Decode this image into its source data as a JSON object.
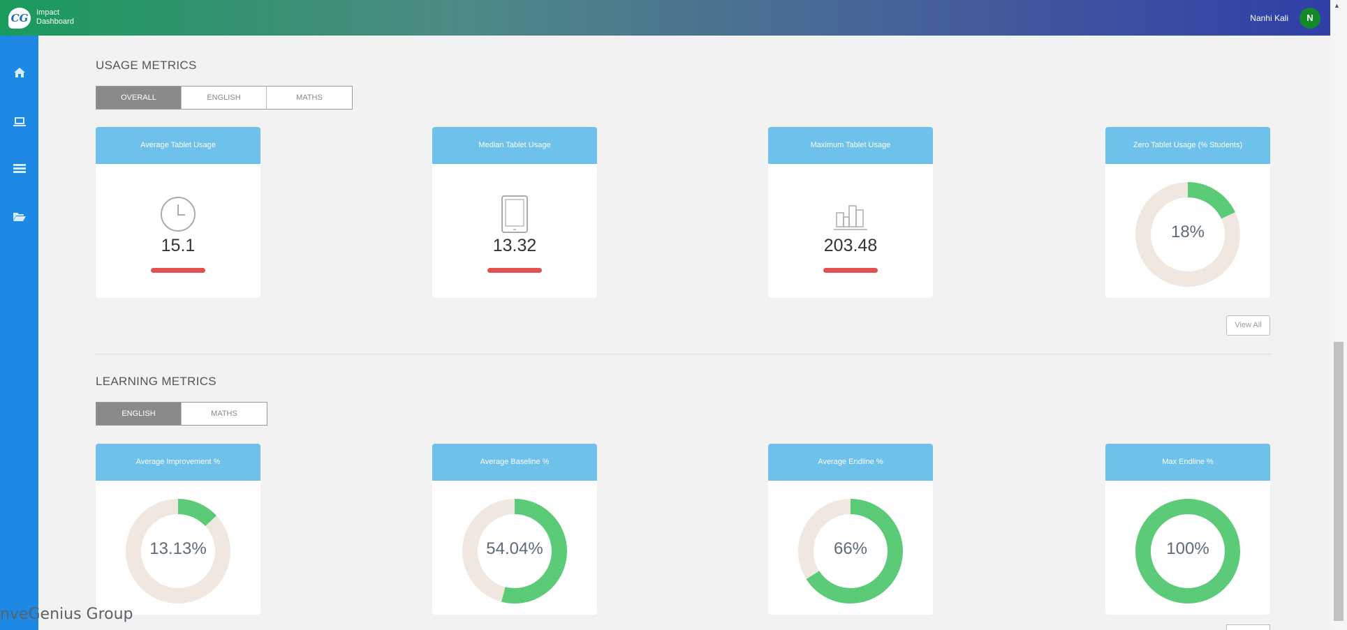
{
  "header": {
    "logo_text": "CG",
    "app_title": "Impact Dashboard",
    "user_name": "Nanhi Kali",
    "avatar_initial": "N"
  },
  "sidebar": {
    "items": [
      {
        "icon": "home-icon"
      },
      {
        "icon": "laptop-icon"
      },
      {
        "icon": "list-icon"
      },
      {
        "icon": "folder-open-icon"
      }
    ]
  },
  "usage": {
    "title": "USAGE METRICS",
    "tabs": [
      {
        "label": "OVERALL",
        "active": true
      },
      {
        "label": "ENGLISH",
        "active": false
      },
      {
        "label": "MATHS",
        "active": false
      }
    ],
    "cards": [
      {
        "title": "Average Tablet Usage",
        "value": "15.1",
        "icon": "clock-icon"
      },
      {
        "title": "Median Tablet Usage",
        "value": "13.32",
        "icon": "tablet-icon"
      },
      {
        "title": "Maximum Tablet Usage",
        "value": "203.48",
        "icon": "bar-chart-icon"
      },
      {
        "title": "Zero Tablet Usage (% Students)",
        "value": "18%",
        "percent": 18
      }
    ],
    "view_all": "View All"
  },
  "learning": {
    "title": "LEARNING METRICS",
    "tabs": [
      {
        "label": "ENGLISH",
        "active": true
      },
      {
        "label": "MATHS",
        "active": false
      }
    ],
    "cards": [
      {
        "title": "Average Improvement %",
        "value": "13.13%",
        "percent": 13.13
      },
      {
        "title": "Average Baseline %",
        "value": "54.04%",
        "percent": 54.04
      },
      {
        "title": "Average Endline %",
        "value": "66%",
        "percent": 66
      },
      {
        "title": "Max Endline %",
        "value": "100%",
        "percent": 100
      }
    ]
  },
  "colors": {
    "donut_fill": "#5ccb78",
    "donut_track": "#f0e8e0",
    "card_header": "#6ec1ea",
    "underline": "#e05050",
    "sidebar": "#1e88e5"
  },
  "watermark": "nveGenius Group"
}
